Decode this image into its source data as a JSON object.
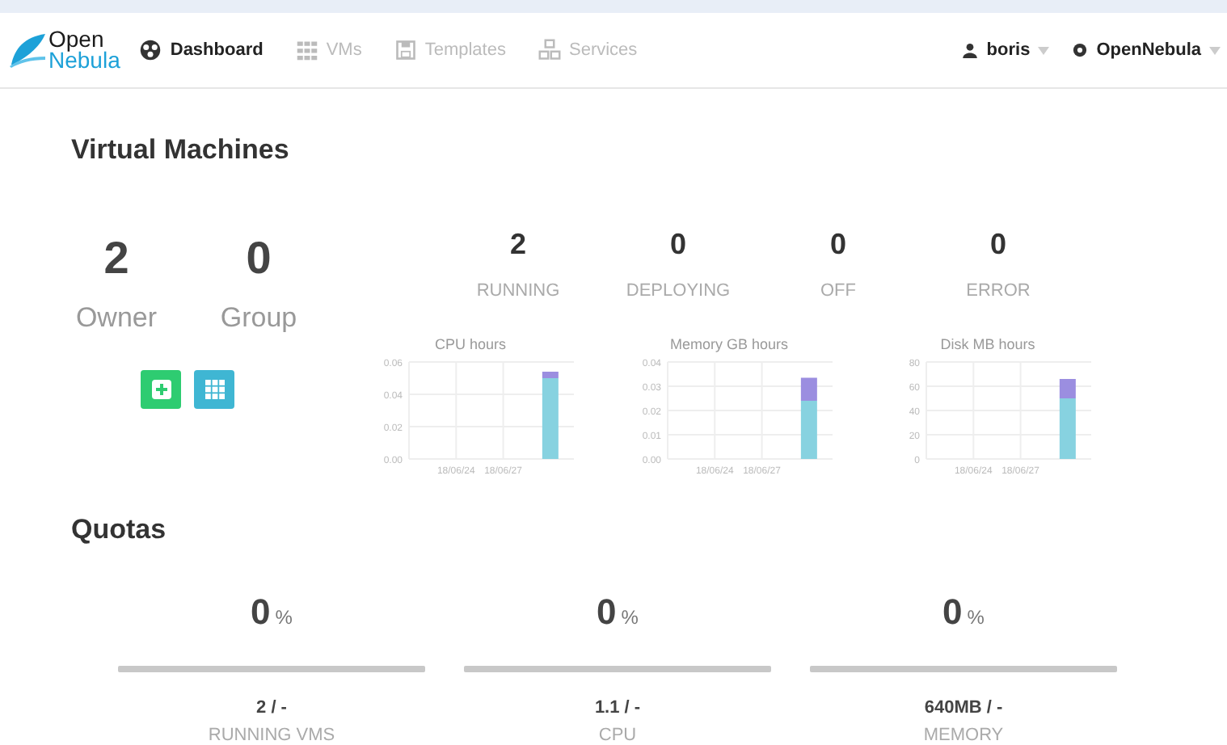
{
  "header": {
    "logo": [
      "Open",
      "Nebula"
    ],
    "nav": [
      {
        "label": "Dashboard",
        "selected": true
      },
      {
        "label": "VMs",
        "selected": false
      },
      {
        "label": "Templates",
        "selected": false
      },
      {
        "label": "Services",
        "selected": false
      }
    ],
    "user": {
      "label": "boris"
    },
    "zone": {
      "label": "OpenNebula"
    }
  },
  "virtual_machines": {
    "title": "Virtual Machines",
    "totals": [
      {
        "value": "2",
        "label": "Owner"
      },
      {
        "value": "0",
        "label": "Group"
      }
    ],
    "buttons": [
      {
        "kind": "create",
        "color": "#2ecc71"
      },
      {
        "kind": "list",
        "color": "#3fb6d3"
      }
    ],
    "states": [
      {
        "value": "2",
        "label": "RUNNING"
      },
      {
        "value": "0",
        "label": "DEPLOYING"
      },
      {
        "value": "0",
        "label": "OFF"
      },
      {
        "value": "0",
        "label": "ERROR"
      }
    ],
    "charts": [
      {
        "chart_data": {
          "type": "bar",
          "stacked": true,
          "title": "CPU hours",
          "grid": true,
          "categories": [
            null,
            "18/06/24",
            "18/06/27",
            null
          ],
          "ylim": [
            0,
            0.06
          ],
          "yticks": [
            {
              "value": 0,
              "label": "0.00"
            },
            {
              "value": 0.02,
              "label": "0.02"
            },
            {
              "value": 0.04,
              "label": "0.04"
            },
            {
              "value": 0.06,
              "label": "0.06"
            }
          ],
          "series": [
            {
              "color": "#87d2e0",
              "values": [
                null,
                null,
                null,
                0.05
              ]
            },
            {
              "color": "#9b8ee0",
              "values": [
                null,
                null,
                null,
                0.004
              ]
            }
          ]
        }
      },
      {
        "chart_data": {
          "type": "bar",
          "stacked": true,
          "title": "Memory GB hours",
          "grid": true,
          "categories": [
            null,
            "18/06/24",
            "18/06/27",
            null
          ],
          "ylim": [
            0,
            0.04
          ],
          "yticks": [
            {
              "value": 0,
              "label": "0.00"
            },
            {
              "value": 0.01,
              "label": "0.01"
            },
            {
              "value": 0.02,
              "label": "0.02"
            },
            {
              "value": 0.03,
              "label": "0.03"
            },
            {
              "value": 0.04,
              "label": "0.04"
            }
          ],
          "series": [
            {
              "color": "#87d2e0",
              "values": [
                null,
                null,
                null,
                0.024
              ]
            },
            {
              "color": "#9b8ee0",
              "values": [
                null,
                null,
                null,
                0.0095
              ]
            }
          ]
        }
      },
      {
        "chart_data": {
          "type": "bar",
          "stacked": true,
          "title": "Disk MB hours",
          "grid": true,
          "categories": [
            null,
            "18/06/24",
            "18/06/27",
            null
          ],
          "ylim": [
            0,
            80
          ],
          "yticks": [
            {
              "value": 0,
              "label": "0"
            },
            {
              "value": 20,
              "label": "20"
            },
            {
              "value": 40,
              "label": "40"
            },
            {
              "value": 60,
              "label": "60"
            },
            {
              "value": 80,
              "label": "80"
            }
          ],
          "series": [
            {
              "color": "#87d2e0",
              "values": [
                null,
                null,
                null,
                50
              ]
            },
            {
              "color": "#9b8ee0",
              "values": [
                null,
                null,
                null,
                16
              ]
            }
          ]
        }
      }
    ]
  },
  "quotas": {
    "title": "Quotas",
    "items": [
      {
        "percent": "0",
        "unit": "%",
        "level": 0,
        "usage": "2 / -",
        "label": "RUNNING VMS"
      },
      {
        "percent": "0",
        "unit": "%",
        "level": 0,
        "usage": "1.1 / -",
        "label": "CPU"
      },
      {
        "percent": "0",
        "unit": "%",
        "level": 0,
        "usage": "640MB / -",
        "label": "MEMORY"
      }
    ]
  }
}
